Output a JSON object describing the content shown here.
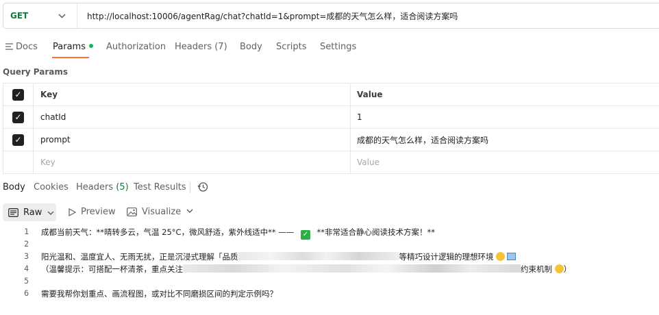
{
  "request": {
    "method": "GET",
    "url": "http://localhost:10006/agentRag/chat?chatId=1&prompt=成都的天气怎么样，适合阅读方案吗"
  },
  "request_tabs": [
    {
      "label": "Docs"
    },
    {
      "label": "Params"
    },
    {
      "label": "Authorization"
    },
    {
      "label": "Headers (7)"
    },
    {
      "label": "Body"
    },
    {
      "label": "Scripts"
    },
    {
      "label": "Settings"
    }
  ],
  "query_params": {
    "title": "Query Params",
    "header": {
      "key": "Key",
      "value": "Value"
    },
    "rows": [
      {
        "key": "chatId",
        "value": "1"
      },
      {
        "key": "prompt",
        "value": "成都的天气怎么样，适合阅读方案吗"
      }
    ],
    "placeholder": {
      "key": "Key",
      "value": "Value"
    }
  },
  "response_tabs": [
    {
      "label": "Body"
    },
    {
      "label": "Cookies"
    },
    {
      "label": "Headers",
      "count": "(5)"
    },
    {
      "label": "Test Results"
    }
  ],
  "body_toolbar": {
    "raw": "Raw",
    "preview": "Preview",
    "visualize": "Visualize"
  },
  "code_lines": [
    {
      "n": "1",
      "a": "成都当前天气：**晴转多云，气温 25°C，微风舒适，紫外线适中** —— ",
      "b": " **非常适合静心阅读技术方案！**"
    },
    {
      "n": "2",
      "a": ""
    },
    {
      "n": "3",
      "a": "阳光温和、温度宜人、无雨无扰，正是沉浸式理解「品质",
      "b": "等精巧设计逻辑的理想环境 "
    },
    {
      "n": "4",
      "a": "（温馨提示：可搭配一杯清茶，重点关注",
      "b": "约束机制 ",
      "c": "）"
    },
    {
      "n": "5",
      "a": ""
    },
    {
      "n": "6",
      "a": "需要我帮你划重点、画流程图，或对比不同磨损区间的判定示例吗？"
    }
  ],
  "colors": {
    "accent": "#ff6c37",
    "get_method": "#0f7b3a",
    "active_dot": "#0cbb52"
  }
}
